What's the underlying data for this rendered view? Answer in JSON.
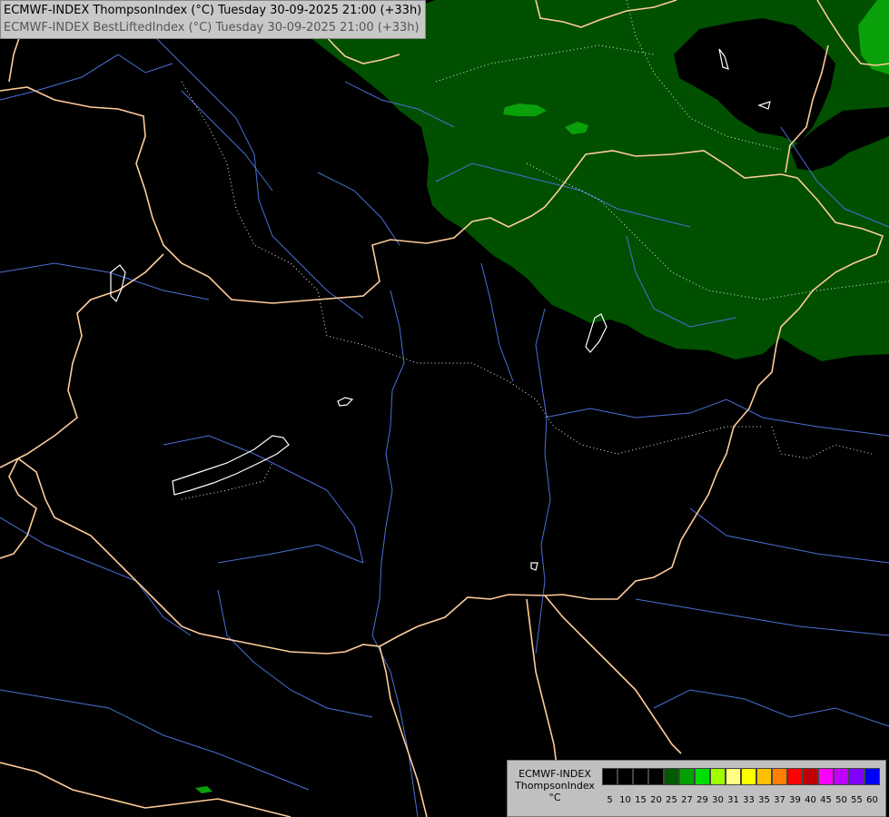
{
  "header": {
    "line1": "ECMWF-INDEX ThompsonIndex (°C) Tuesday 30-09-2025 21:00 (+33h)",
    "line2": "ECMWF-INDEX BestLiftedIndex (°C) Tuesday 30-09-2025 21:00 (+33h)"
  },
  "legend": {
    "model": "ECMWF-INDEX",
    "param": "ThompsonIndex",
    "unit": "°C",
    "ticks": [
      "5",
      "10",
      "15",
      "20",
      "25",
      "27",
      "29",
      "30",
      "31",
      "33",
      "35",
      "37",
      "39",
      "40",
      "45",
      "50",
      "55",
      "60"
    ],
    "colors": [
      "#000000",
      "#000000",
      "#000000",
      "#000000",
      "#005a00",
      "#00a000",
      "#00dd00",
      "#a0ff00",
      "#ffff80",
      "#ffff00",
      "#ffc000",
      "#ff8000",
      "#ff0000",
      "#c00000",
      "#ff00ff",
      "#c000ff",
      "#8000ff",
      "#0000ff"
    ]
  },
  "map": {
    "region": "central-europe-hungary",
    "colors": {
      "background": "#000000",
      "field_dark": "#005000",
      "field_light": "#0aa00a",
      "border": "#ffcc99",
      "river": "#4a6fd8",
      "province": "#e8e8e8",
      "lake": "#ffffff"
    }
  }
}
